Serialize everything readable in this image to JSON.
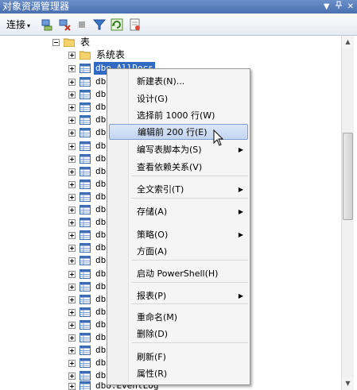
{
  "window": {
    "title": "对象资源管理器"
  },
  "toolbar": {
    "connect_label": "连接",
    "connect_arrow": "▾"
  },
  "tree": {
    "tables_label": "表",
    "system_tables_label": "系统表",
    "selected_item_label": "dbo.AllDocs",
    "partial_label": "dbo.",
    "last_item_label": "dbo.EventLog"
  },
  "context_menu": {
    "items": [
      {
        "label": "新建表(N)..."
      },
      {
        "label": "设计(G)"
      },
      {
        "label": "选择前 1000 行(W)"
      },
      {
        "label": "编辑前 200 行(E)"
      },
      {
        "label": "编写表脚本为(S)"
      },
      {
        "label": "查看依赖关系(V)"
      },
      {
        "label": "全文索引(T)"
      },
      {
        "label": "存储(A)"
      },
      {
        "label": "策略(O)"
      },
      {
        "label": "方面(A)"
      },
      {
        "label": "启动 PowerShell(H)"
      },
      {
        "label": "报表(P)"
      },
      {
        "label": "重命名(M)"
      },
      {
        "label": "删除(D)"
      },
      {
        "label": "刷新(F)"
      },
      {
        "label": "属性(R)"
      }
    ],
    "submenu_arrow": "▶"
  },
  "colors": {
    "title_bar": "#4a70b0",
    "selection": "#316ac5",
    "menu_highlight": "#c3d5f0"
  },
  "icons": [
    "pin-icon",
    "close-icon",
    "connect-icon",
    "disconnect-icon",
    "stop-icon",
    "filter-icon",
    "refresh-icon",
    "summary-icon",
    "folder-icon",
    "table-icon"
  ]
}
